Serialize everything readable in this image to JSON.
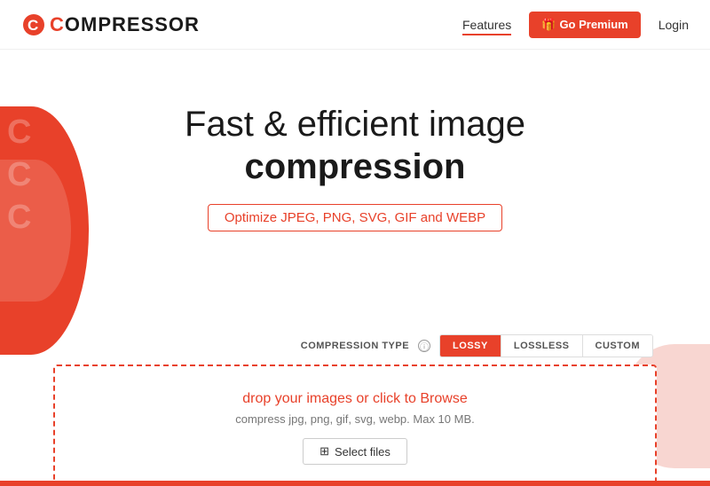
{
  "nav": {
    "logo_text": "COMPRESSOR",
    "features_label": "Features",
    "premium_label": "Go Premium",
    "login_label": "Login"
  },
  "hero": {
    "headline_line1": "Fast & efficient image",
    "headline_line2": "compression",
    "subtitle": "Optimize JPEG, PNG, SVG, GIF and WEBP"
  },
  "compression": {
    "type_label": "COMPRESSION TYPE",
    "info_icon_label": "ⓘ",
    "buttons": [
      {
        "label": "LOSSY",
        "active": true
      },
      {
        "label": "LOSSLESS",
        "active": false
      },
      {
        "label": "CUSTOM",
        "active": false
      }
    ]
  },
  "dropzone": {
    "main_text": "drop your images or click to Browse",
    "sub_text": "compress jpg, png, gif, svg, webp. Max 10 MB.",
    "select_button_label": "Select files"
  }
}
